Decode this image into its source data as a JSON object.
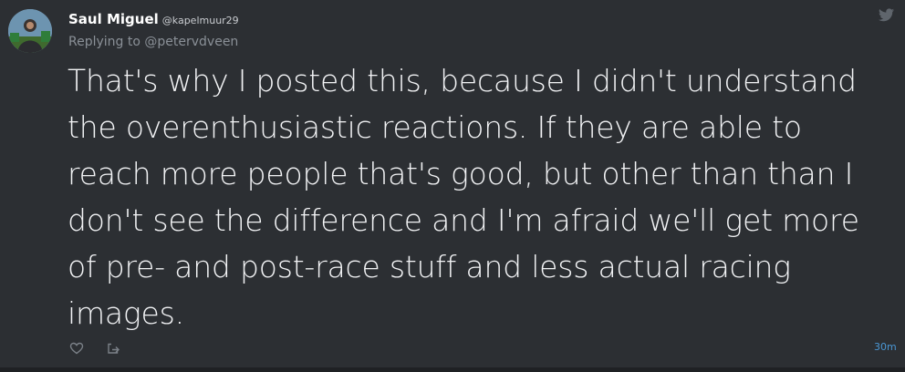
{
  "tweet": {
    "author_name": "Saul Miguel",
    "author_handle": "@kapelmuur29",
    "replying_prefix": "Replying to ",
    "replying_to": "@petervdveen",
    "text": "That's why I posted this, because I didn't understand the overenthusiastic reactions. If they are able to reach more people that's good, but other than than I don't see the difference and I'm afraid we'll get more of pre- and post-race stuff and less actual racing images.",
    "timestamp": "30m"
  },
  "icons": {
    "brand": "twitter-bird-icon",
    "like": "heart-icon",
    "share": "share-icon"
  },
  "colors": {
    "background": "#2c2f33",
    "link": "#4a97d4",
    "muted": "#8a9097"
  }
}
